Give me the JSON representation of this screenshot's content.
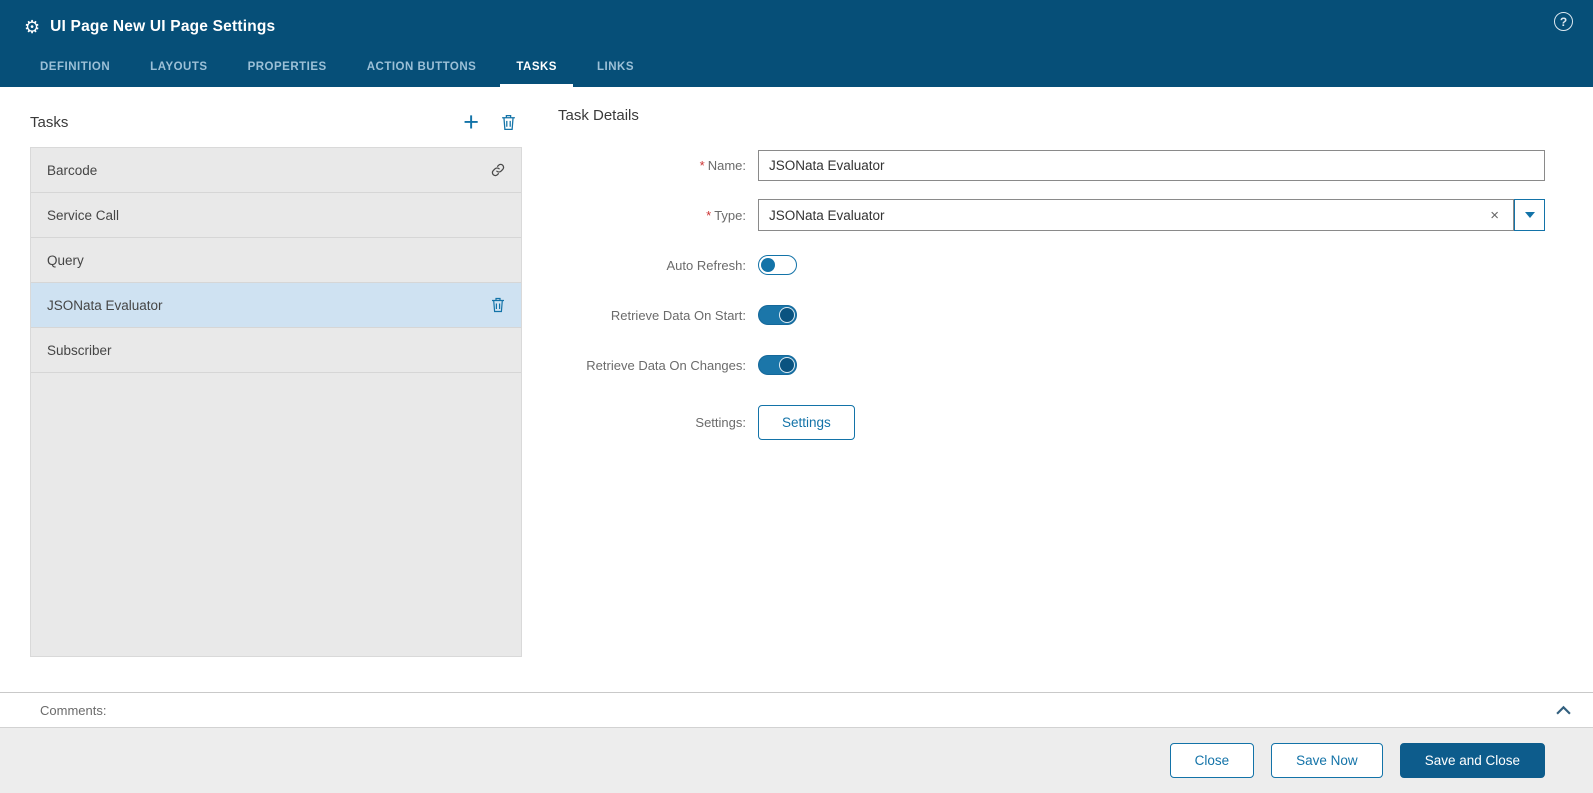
{
  "colors": {
    "header_bg": "#064f78",
    "accent": "#1373a8",
    "primary_button_bg": "#0d5c8c",
    "selected_row_bg": "#cfe2f2"
  },
  "header": {
    "gear_icon": "⚙",
    "title": "UI Page New UI Page Settings",
    "help_icon": "?",
    "tabs": [
      {
        "label": "DEFINITION",
        "active": false
      },
      {
        "label": "LAYOUTS",
        "active": false
      },
      {
        "label": "PROPERTIES",
        "active": false
      },
      {
        "label": "ACTION BUTTONS",
        "active": false
      },
      {
        "label": "TASKS",
        "active": true
      },
      {
        "label": "LINKS",
        "active": false
      }
    ]
  },
  "tasks_panel": {
    "title": "Tasks",
    "add_icon": "+",
    "items": [
      {
        "label": "Barcode",
        "icon": "link-icon",
        "selected": false
      },
      {
        "label": "Service Call",
        "icon": "",
        "selected": false
      },
      {
        "label": "Query",
        "icon": "",
        "selected": false
      },
      {
        "label": "JSONata Evaluator",
        "icon": "trash-icon",
        "selected": true
      },
      {
        "label": "Subscriber",
        "icon": "",
        "selected": false
      }
    ]
  },
  "details": {
    "title": "Task Details",
    "required_marker": "*",
    "name_label": "Name:",
    "name_value": "JSONata Evaluator",
    "type_label": "Type:",
    "type_value": "JSONata Evaluator",
    "clear_icon": "×",
    "auto_refresh_label": "Auto Refresh:",
    "retrieve_start_label": "Retrieve Data On Start:",
    "retrieve_changes_label": "Retrieve Data On Changes:",
    "settings_label": "Settings:",
    "settings_button": "Settings",
    "toggles": {
      "auto_refresh": false,
      "retrieve_on_start": true,
      "retrieve_on_changes": true
    }
  },
  "comments": {
    "label": "Comments:"
  },
  "footer": {
    "close": "Close",
    "save_now": "Save Now",
    "save_and_close": "Save and Close"
  }
}
